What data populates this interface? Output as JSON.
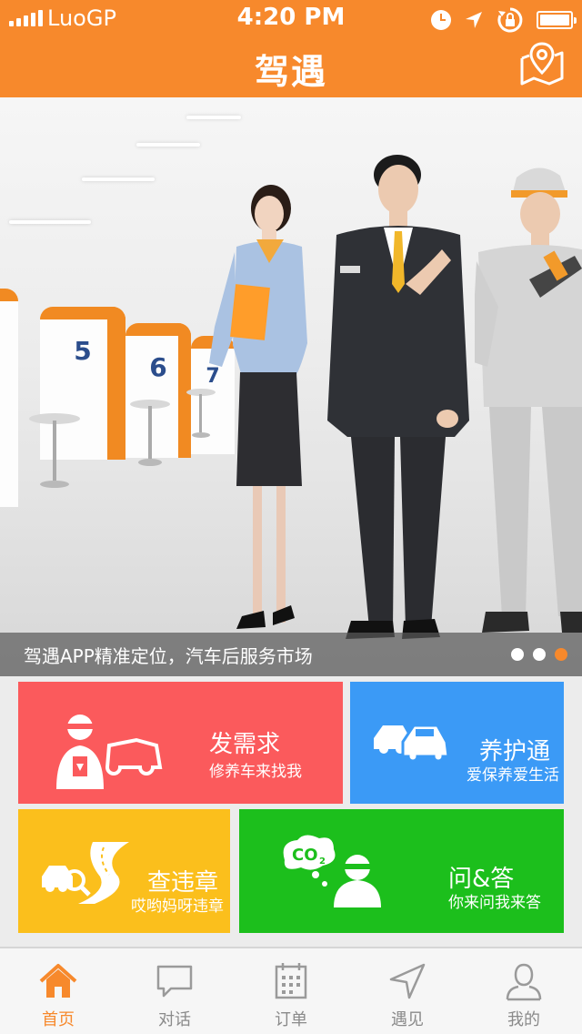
{
  "status_bar": {
    "carrier": "LuoGP",
    "time": "4:20 PM"
  },
  "nav": {
    "title": "驾遇",
    "map_icon": "map-location-icon"
  },
  "banner": {
    "caption": "驾遇APP精准定位，汽车后服务市场",
    "counter_numbers": [
      "5",
      "6",
      "7"
    ],
    "slide_count": 3,
    "active_slide": 3
  },
  "tiles": [
    {
      "title": "发需求",
      "subtitle": "修养车来找我",
      "color": "#fb5a5c",
      "icon": "mechanic-car-icon"
    },
    {
      "title": "养护通",
      "subtitle": "爱保养爱生活",
      "color": "#3b9af6",
      "icon": "two-cars-icon"
    },
    {
      "title": "查违章",
      "subtitle": "哎哟妈呀违章",
      "color": "#fbbf1c",
      "icon": "road-car-search-icon"
    },
    {
      "title": "问&答",
      "subtitle": "你来问我来答",
      "color": "#1cbf1c",
      "icon": "co2-mechanic-icon"
    }
  ],
  "tabbar": {
    "items": [
      {
        "label": "首页",
        "icon": "home-icon",
        "active": true
      },
      {
        "label": "对话",
        "icon": "chat-icon",
        "active": false
      },
      {
        "label": "订单",
        "icon": "calendar-icon",
        "active": false
      },
      {
        "label": "遇见",
        "icon": "navigation-arrow-icon",
        "active": false
      },
      {
        "label": "我的",
        "icon": "user-icon",
        "active": false
      }
    ],
    "active_color": "#f7892c",
    "inactive_color": "#8a8a8a"
  }
}
